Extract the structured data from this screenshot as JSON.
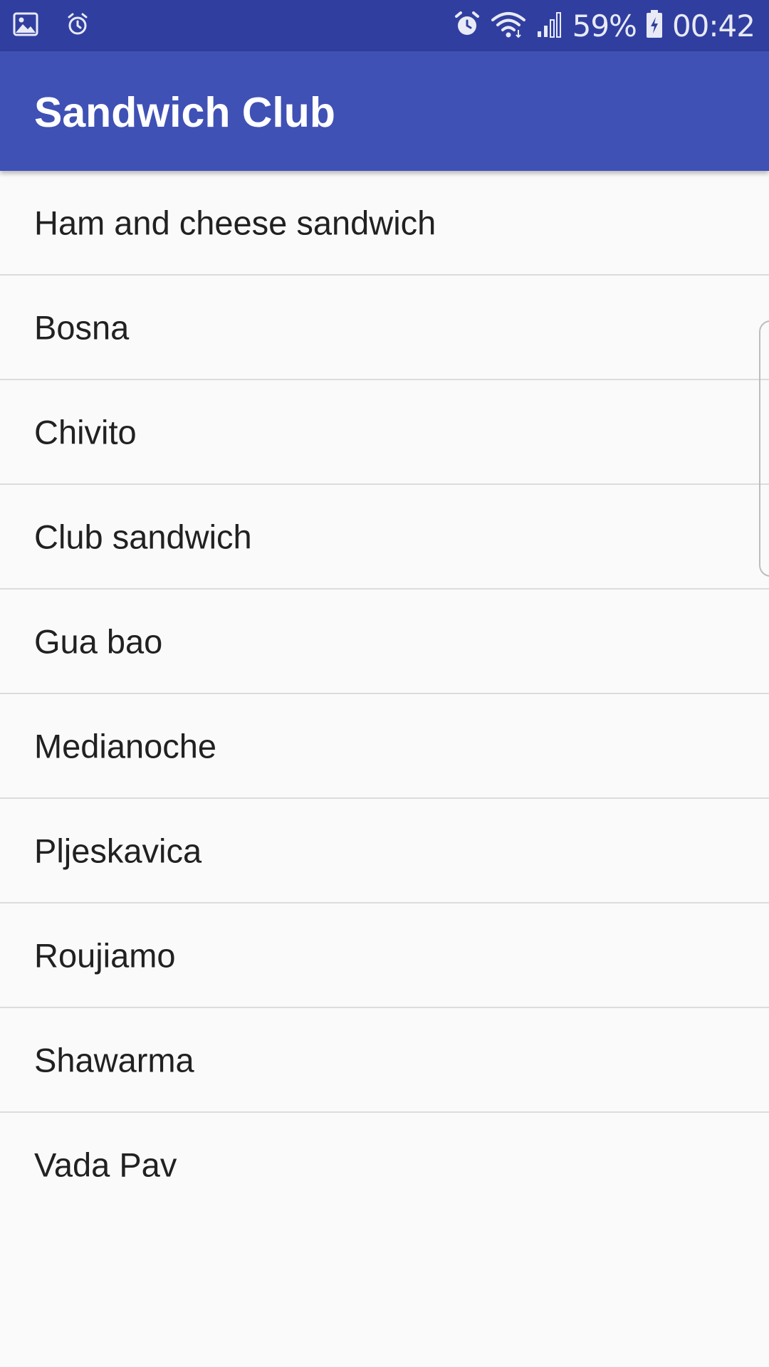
{
  "status_bar": {
    "battery": "59%",
    "time": "00:42",
    "icons": [
      "gallery-icon",
      "alarm-outline-icon",
      "alarm-icon",
      "wifi-icon",
      "signal-icon",
      "battery-charging-icon"
    ]
  },
  "app_bar": {
    "title": "Sandwich Club",
    "color": "#3f51b5",
    "status_color": "#303f9f"
  },
  "sandwiches": [
    {
      "name": "Ham and cheese sandwich"
    },
    {
      "name": "Bosna"
    },
    {
      "name": "Chivito"
    },
    {
      "name": "Club sandwich"
    },
    {
      "name": "Gua bao"
    },
    {
      "name": "Medianoche"
    },
    {
      "name": "Pljeskavica"
    },
    {
      "name": "Roujiamo"
    },
    {
      "name": "Shawarma"
    },
    {
      "name": "Vada Pav"
    }
  ]
}
